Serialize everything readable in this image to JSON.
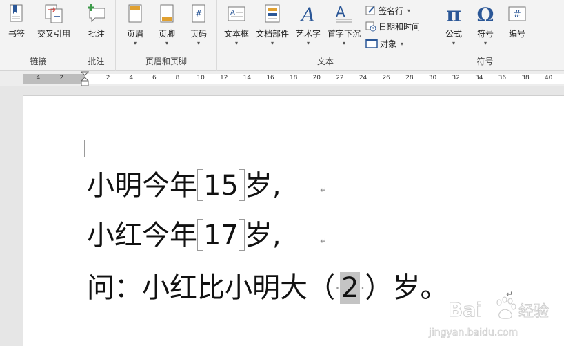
{
  "ribbon": {
    "groups": [
      {
        "label": "链接",
        "buttons": [
          {
            "label": "书签"
          },
          {
            "label": "交叉引用"
          }
        ]
      },
      {
        "label": "批注",
        "buttons": [
          {
            "label": "批注"
          }
        ]
      },
      {
        "label": "页眉和页脚",
        "buttons": [
          {
            "label": "页眉"
          },
          {
            "label": "页脚"
          },
          {
            "label": "页码"
          }
        ]
      },
      {
        "label": "文本",
        "buttons": [
          {
            "label": "文本框"
          },
          {
            "label": "文档部件"
          },
          {
            "label": "艺术字"
          },
          {
            "label": "首字下沉"
          }
        ],
        "small_buttons": [
          {
            "label": "签名行"
          },
          {
            "label": "日期和时间"
          },
          {
            "label": "对象"
          }
        ]
      },
      {
        "label": "符号",
        "buttons": [
          {
            "label": "公式"
          },
          {
            "label": "符号"
          },
          {
            "label": "编号"
          }
        ]
      }
    ],
    "icon_glyphs": {
      "pi": "π",
      "omega": "Ω",
      "hash": "#",
      "art_a": "A"
    }
  },
  "ruler": {
    "left_labels": [
      "4",
      "2"
    ],
    "right_labels": [
      "2",
      "4",
      "6",
      "8",
      "10",
      "12",
      "14",
      "16",
      "18",
      "20",
      "22",
      "24",
      "26",
      "28",
      "30",
      "32",
      "34",
      "36",
      "38",
      "40"
    ]
  },
  "document": {
    "line1": {
      "prefix": "小明今年",
      "value": "15",
      "suffix": "岁,"
    },
    "line2": {
      "prefix": "小红今年",
      "value": "17",
      "suffix": "岁,"
    },
    "line3": {
      "prefix": "问：小红比小明大（",
      "value": "2",
      "suffix": "）岁。"
    },
    "paragraph_mark": "↵"
  },
  "watermark": {
    "brand": "Bai",
    "brand_suffix": "经验",
    "url": "jingyan.baidu.com"
  },
  "colors": {
    "accent_blue": "#2b5797",
    "accent_green": "#3c9a4a",
    "accent_orange": "#e0a030",
    "selection": "#c4c4c4"
  }
}
